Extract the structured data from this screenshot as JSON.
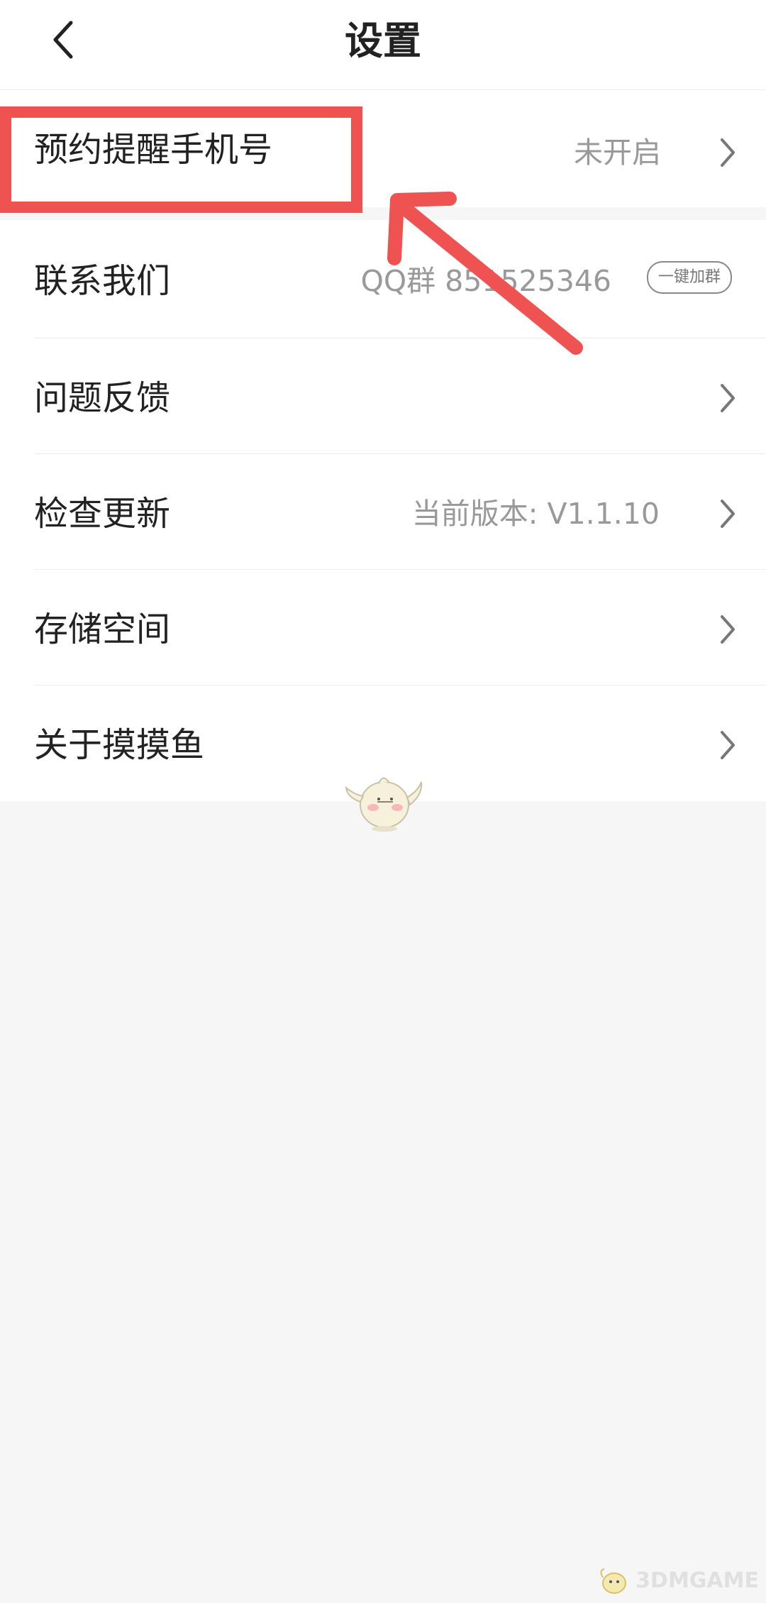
{
  "header": {
    "title": "设置"
  },
  "settings": [
    {
      "label": "预约提醒手机号",
      "value": "未开启"
    },
    {
      "label": "联系我们",
      "value": "QQ群 851525346",
      "action": "一键加群"
    },
    {
      "label": "问题反馈",
      "value": ""
    },
    {
      "label": "检查更新",
      "value": "当前版本: V1.1.10"
    },
    {
      "label": "存储空间",
      "value": ""
    },
    {
      "label": "关于摸摸鱼",
      "value": ""
    }
  ],
  "colors": {
    "highlight": "#ee5352",
    "background": "#f6f6f6",
    "text": "#222222",
    "muted": "#999999"
  },
  "icons": {
    "back": "chevron-left-icon",
    "row": "chevron-right-icon"
  },
  "watermark": {
    "text": "3DMGAME"
  }
}
